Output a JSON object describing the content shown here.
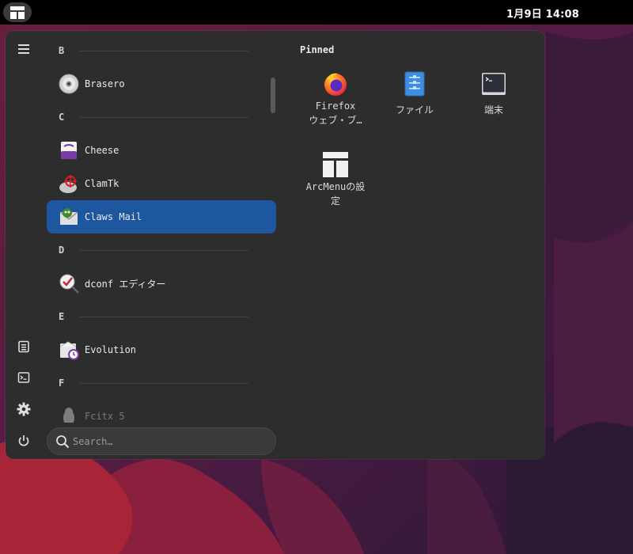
{
  "topbar": {
    "clock": "1月9日  14:08",
    "activities_icon": "layout-grid-icon"
  },
  "sidebar": {
    "buttons": [
      {
        "name": "hamburger-menu-icon"
      },
      {
        "name": "document-icon"
      },
      {
        "name": "terminal-icon"
      },
      {
        "name": "settings-icon"
      },
      {
        "name": "power-icon"
      }
    ]
  },
  "applist": {
    "sections": [
      {
        "letter": "B"
      },
      {
        "letter": "C"
      },
      {
        "letter": "D"
      },
      {
        "letter": "E"
      },
      {
        "letter": "F"
      }
    ],
    "apps": [
      {
        "label": "Brasero",
        "icon": "disc-icon"
      },
      {
        "label": "Cheese",
        "icon": "cheese-camera-icon"
      },
      {
        "label": "ClamTk",
        "icon": "clamtk-icon"
      },
      {
        "label": "Claws Mail",
        "icon": "claws-mail-icon",
        "selected": true
      },
      {
        "label": "dconf エディター",
        "icon": "dconf-icon"
      },
      {
        "label": "Evolution",
        "icon": "evolution-icon"
      },
      {
        "label": "Fcitx 5",
        "icon": "penguin-icon"
      }
    ]
  },
  "search": {
    "placeholder": "Search…"
  },
  "pinned": {
    "title": "Pinned",
    "items": [
      {
        "label_line1": "Firefox",
        "label_line2": "ウェブ・ブ…",
        "icon": "firefox-icon"
      },
      {
        "label_line1": "ファイル",
        "icon": "files-icon"
      },
      {
        "label_line1": "端末",
        "icon": "terminal-icon"
      },
      {
        "label_line1": "ArcMenuの設",
        "label_line2": "定",
        "icon": "arcmenu-icon"
      }
    ]
  },
  "colors": {
    "panel": "#2d2d2d",
    "selection": "#1c57a0",
    "topbar": "#000000"
  }
}
